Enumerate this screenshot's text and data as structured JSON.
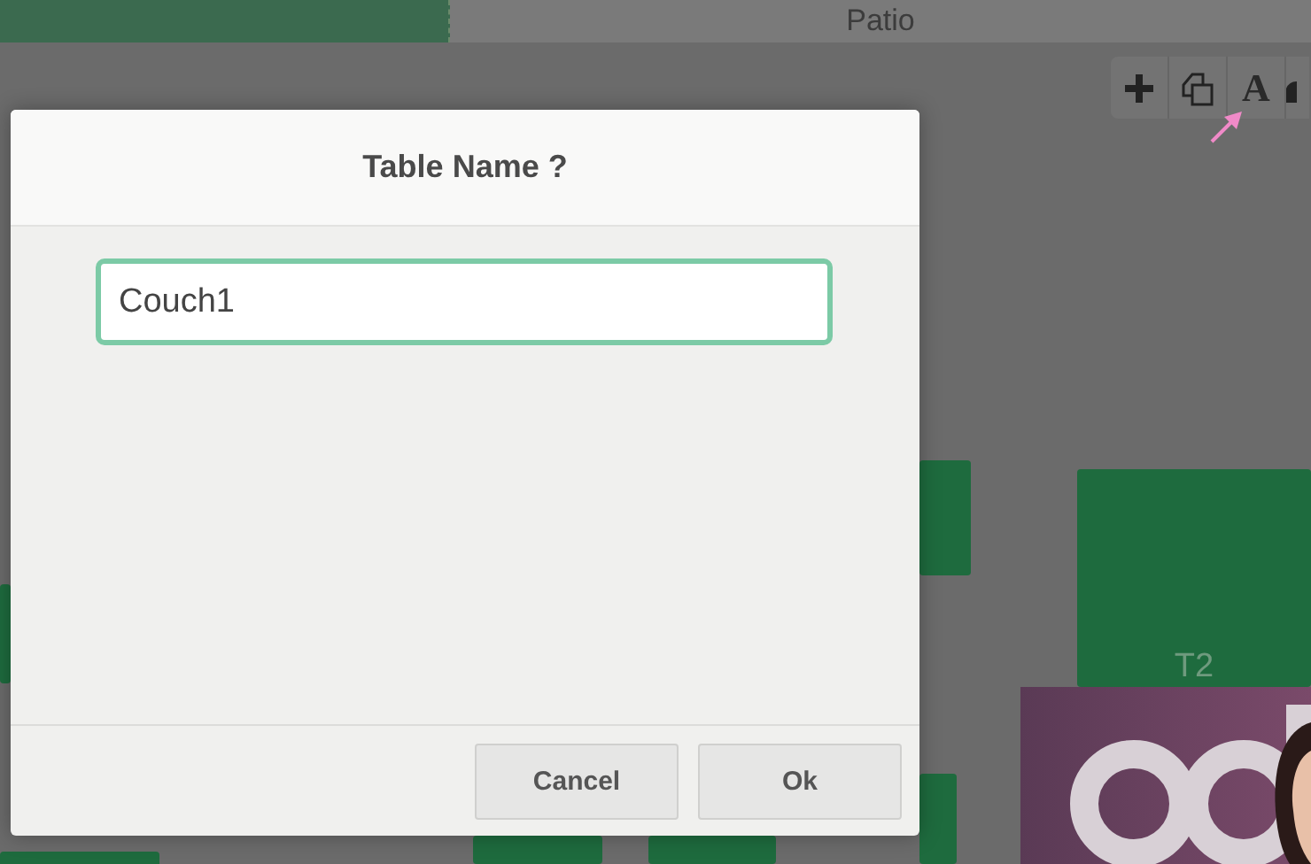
{
  "floor_tabs": [
    {
      "selected": true
    },
    {
      "label": "Patio",
      "selected": false
    }
  ],
  "toolbar": [
    {
      "kind": "add"
    },
    {
      "kind": "duplicate"
    },
    {
      "kind": "text",
      "label": "A"
    },
    {
      "kind": "partial"
    }
  ],
  "tables": [
    {
      "label": "T2"
    }
  ],
  "dialog": {
    "title": "Table Name ?",
    "input": {
      "value": "Couch1"
    },
    "buttons": [
      "Cancel",
      "Ok"
    ]
  }
}
